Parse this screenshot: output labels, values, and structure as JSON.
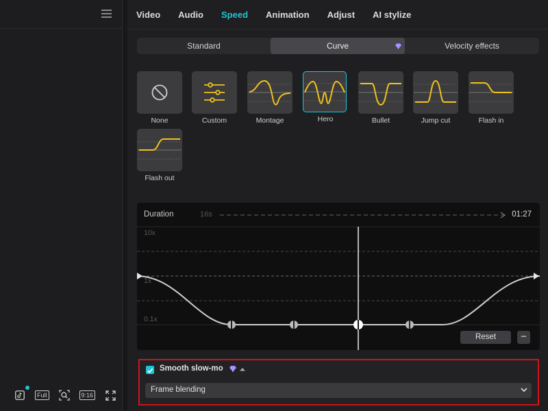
{
  "left_pane": {
    "toolbar": {
      "tiktok_icon": "tiktok-icon",
      "full_label": "Full",
      "zoom_icon": "zoom-icon",
      "ratio_label": "9:16",
      "expand_icon": "fullscreen-icon"
    }
  },
  "tabs": [
    "Video",
    "Audio",
    "Speed",
    "Animation",
    "Adjust",
    "AI stylize"
  ],
  "active_tab": "Speed",
  "speed_modes": {
    "standard": "Standard",
    "curve": "Curve",
    "velocity": "Velocity effects",
    "active": "Curve"
  },
  "presets": [
    {
      "label": "None"
    },
    {
      "label": "Custom"
    },
    {
      "label": "Montage"
    },
    {
      "label": "Hero"
    },
    {
      "label": "Bullet"
    },
    {
      "label": "Jump cut"
    },
    {
      "label": "Flash in"
    },
    {
      "label": "Flash out"
    }
  ],
  "selected_preset": "Hero",
  "curve_editor": {
    "duration_label": "Duration",
    "duration_start": "16s",
    "duration_end": "01:27",
    "y_labels": {
      "top": "10x",
      "mid": "1x",
      "bottom": "0.1x"
    },
    "reset_label": "Reset",
    "minus_label": "−"
  },
  "smooth_slowmo": {
    "label": "Smooth slow-mo",
    "checked": true,
    "method": "Frame blending"
  },
  "colors": {
    "accent": "#1fc5d4",
    "curve_yellow": "#f1c21b",
    "highlight": "#d4111a",
    "gem": "#9b7bff"
  }
}
